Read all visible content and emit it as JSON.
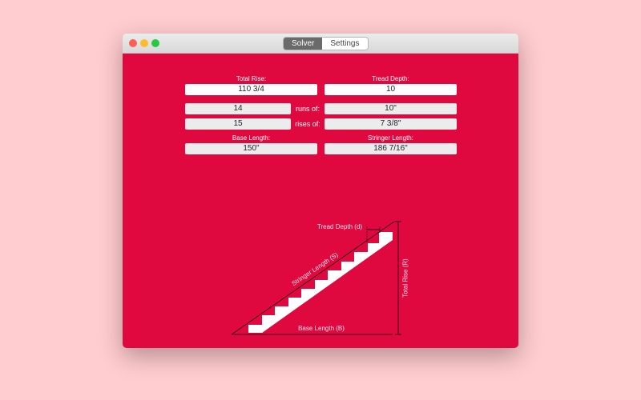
{
  "window": {
    "tabs": [
      "Solver",
      "Settings"
    ],
    "active_tab": "Solver"
  },
  "form": {
    "total_rise_label": "Total Rise:",
    "total_rise": "110 3/4",
    "tread_depth_label": "Tread Depth:",
    "tread_depth": "10",
    "runs_count": "14",
    "runs_label": "runs of:",
    "run_value": "10\"",
    "rises_count": "15",
    "rises_label": "rises of:",
    "rise_value": "7 3/8\"",
    "base_length_label": "Base Length:",
    "base_length": "150\"",
    "stringer_length_label": "Stringer Length:",
    "stringer_length": "186 7/16\""
  },
  "diagram": {
    "tread": "Tread Depth (d)",
    "stringer": "Stringer Length (S)",
    "base": "Base Length (B)",
    "rise": "Total Rise (R)"
  }
}
